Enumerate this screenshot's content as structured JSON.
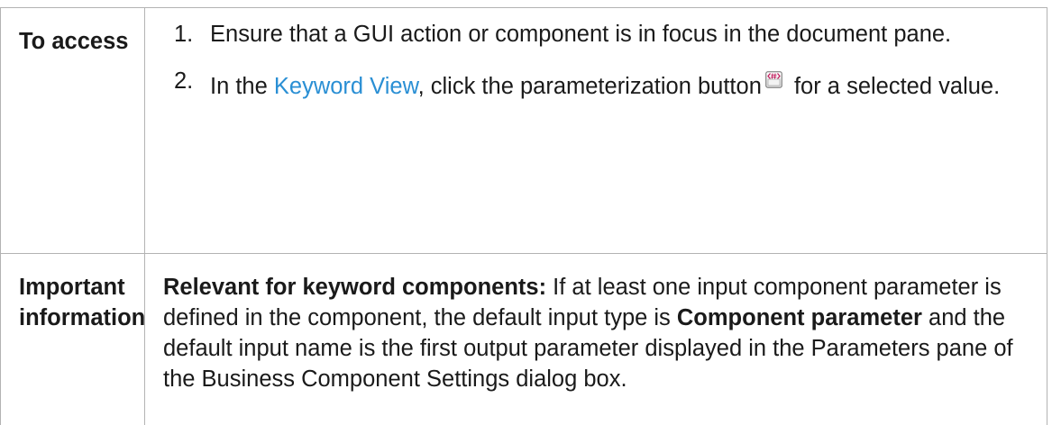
{
  "rows": {
    "access": {
      "header": "To access",
      "steps": [
        {
          "number": "1.",
          "text": "Ensure that a GUI action or component is in focus in the document pane."
        },
        {
          "number": "2.",
          "prefix": "In the ",
          "link": "Keyword View",
          "middle": ", click the parameterization button",
          "icon": "parameterization-icon",
          "suffix": " for a selected value."
        }
      ]
    },
    "important": {
      "header_line1": "Important",
      "header_line2": "information",
      "lead_bold": "Relevant for keyword components:",
      "text_part1": " If at least one input component parameter is defined in the component, the default input type is ",
      "bold_term": "Component parameter",
      "text_part2": " and the default input name is the first output parameter displayed in the Parameters pane of the Business Component Settings dialog box."
    }
  },
  "colors": {
    "link": "#2a8fd4",
    "border": "#b3b3b3",
    "text": "#1a1a1a",
    "icon_accent": "#c2185b"
  }
}
